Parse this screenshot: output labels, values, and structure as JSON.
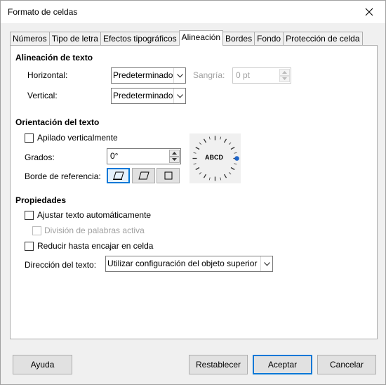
{
  "window": {
    "title": "Formato de celdas"
  },
  "tabs": [
    {
      "label": "Números"
    },
    {
      "label": "Tipo de letra"
    },
    {
      "label": "Efectos tipográficos"
    },
    {
      "label": "Alineación"
    },
    {
      "label": "Bordes"
    },
    {
      "label": "Fondo"
    },
    {
      "label": "Protección de celda"
    }
  ],
  "text_alignment": {
    "title": "Alineación de texto",
    "horizontal_label": "Horizontal:",
    "horizontal_value": "Predeterminado",
    "vertical_label": "Vertical:",
    "vertical_value": "Predeterminado",
    "indent_label": "Sangría:",
    "indent_value": "0 pt"
  },
  "orientation": {
    "title": "Orientación del texto",
    "stacked_label": "Apilado verticalmente",
    "degrees_label": "Grados:",
    "degrees_value": "0°",
    "reference_label": "Borde de referencia:",
    "dial_text": "ABCD"
  },
  "properties": {
    "title": "Propiedades",
    "wrap_label": "Ajustar texto automáticamente",
    "hyphen_label": "División de palabras activa",
    "shrink_label": "Reducir hasta encajar en celda",
    "direction_label": "Dirección del texto:",
    "direction_value": "Utilizar configuración del objeto superior"
  },
  "buttons": {
    "help": "Ayuda",
    "reset": "Restablecer",
    "ok": "Aceptar",
    "cancel": "Cancelar"
  },
  "colors": {
    "accent": "#0078d7",
    "dial_knob": "#1e64c8"
  }
}
